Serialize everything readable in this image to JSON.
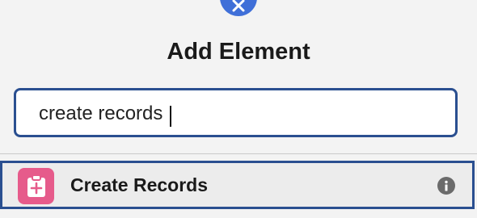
{
  "dialog": {
    "title": "Add Element",
    "close_icon": "close-icon"
  },
  "search": {
    "value": "create records"
  },
  "results": [
    {
      "label": "Create Records",
      "icon": "create-records-icon",
      "icon_color": "#e65b8b",
      "info_icon": "info-icon"
    }
  ],
  "colors": {
    "accent": "#3f6fd8",
    "focus_border": "#2a4f90",
    "background": "#f3f3f3"
  }
}
